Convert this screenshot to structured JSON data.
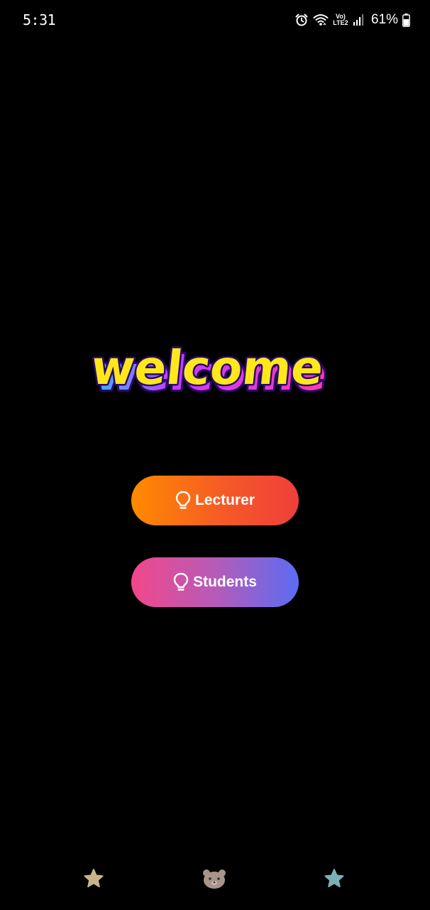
{
  "status_bar": {
    "time": "5:31",
    "network_label_top": "Vo)",
    "network_label_bottom": "LTE2",
    "battery_percent": "61%",
    "icons": [
      "alarm-icon",
      "wifi-icon",
      "signal-icon",
      "battery-icon"
    ]
  },
  "welcome": {
    "text": "welcome",
    "colors": {
      "fill": "#ffe81a",
      "shadow_pink": "#ff3ca8",
      "shadow_blue": "#3ab4ff",
      "outline": "#2a0a6a"
    }
  },
  "buttons": {
    "lecturer": {
      "label": "Lecturer",
      "icon": "lightbulb-icon"
    },
    "students": {
      "label": "Students",
      "icon": "lightbulb-icon"
    }
  },
  "bottom_nav": {
    "items": [
      {
        "icon": "star-icon",
        "color": "#c8b48a"
      },
      {
        "icon": "bear-icon",
        "color": "#a8948a"
      },
      {
        "icon": "star-icon",
        "color": "#7ab0b8"
      }
    ]
  }
}
